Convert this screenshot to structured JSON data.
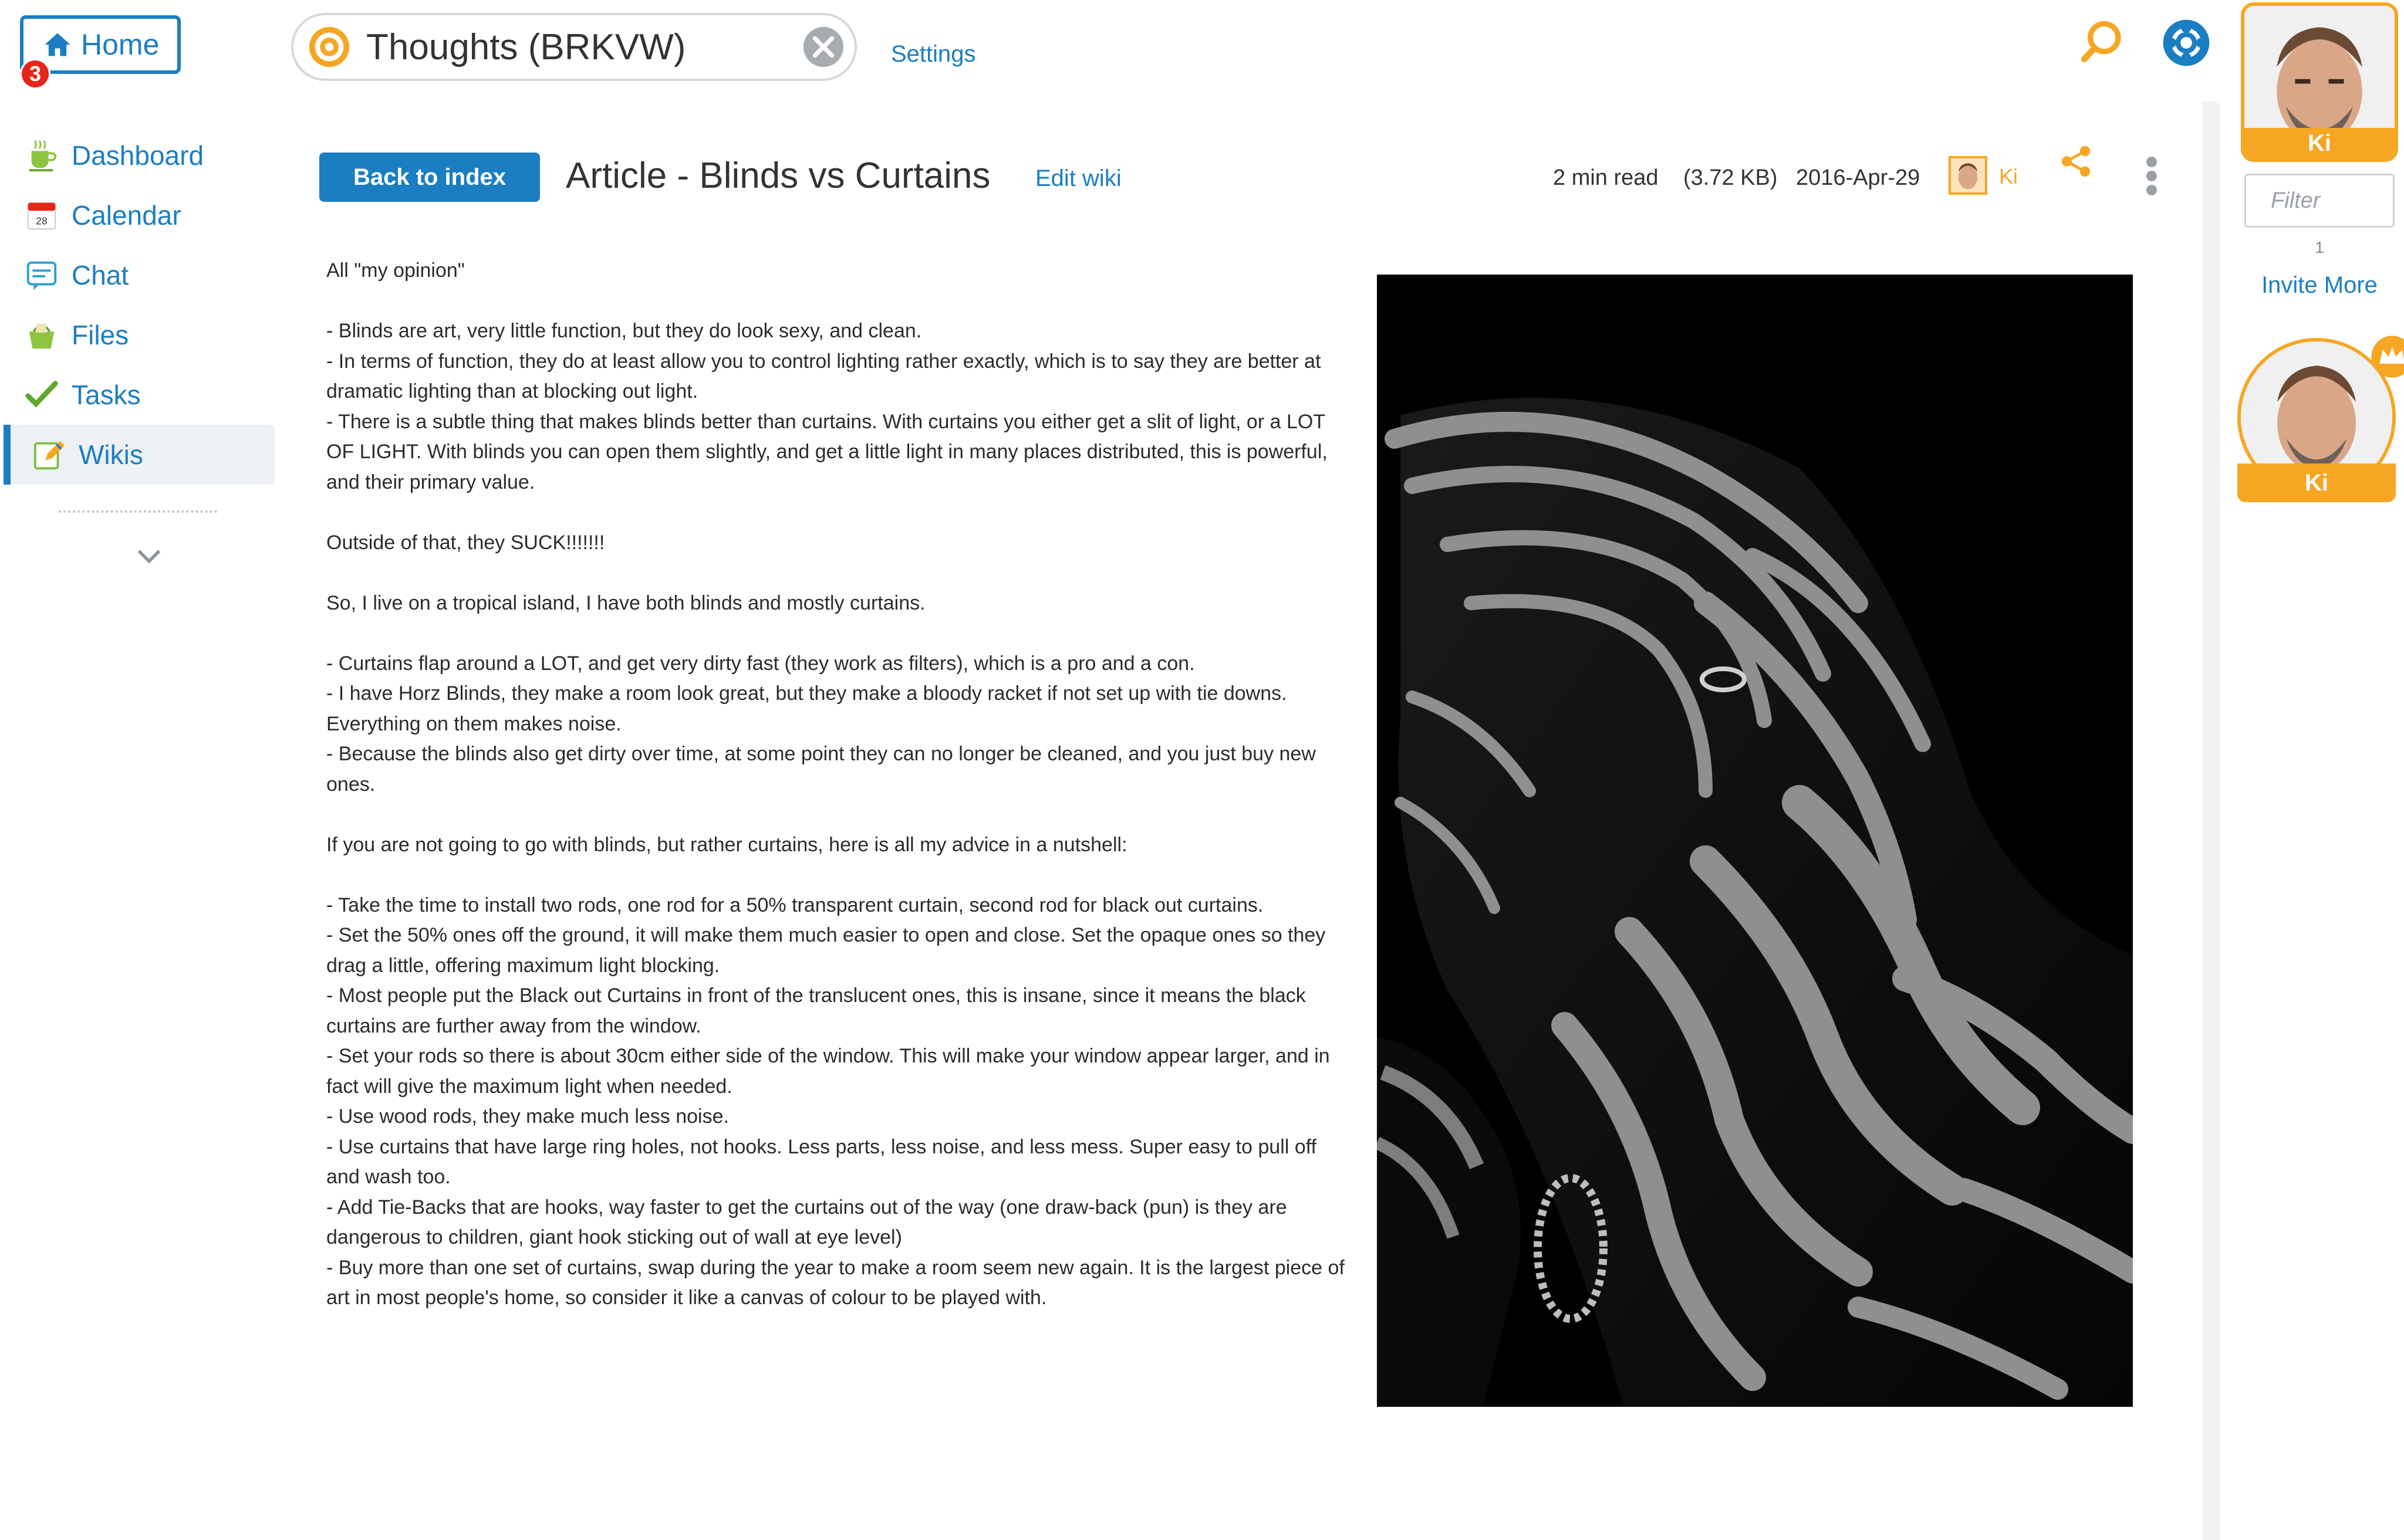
{
  "home": {
    "label": "Home",
    "badge_count": "3"
  },
  "sidebar": {
    "items": [
      {
        "label": "Dashboard",
        "icon": "dashboard-cup-icon"
      },
      {
        "label": "Calendar",
        "icon": "calendar-icon"
      },
      {
        "label": "Chat",
        "icon": "chat-icon"
      },
      {
        "label": "Files",
        "icon": "files-basket-icon"
      },
      {
        "label": "Tasks",
        "icon": "checkmark-icon"
      },
      {
        "label": "Wikis",
        "icon": "wiki-edit-icon",
        "active": true
      }
    ]
  },
  "topbar": {
    "workspace_title": "Thoughts (BRKVW)",
    "settings_label": "Settings"
  },
  "right_panel": {
    "user_name": "Ki",
    "filter_placeholder": "Filter",
    "member_count": "1",
    "invite_label": "Invite More",
    "member_name": "Ki"
  },
  "article": {
    "back_label": "Back to index",
    "title": "Article - Blinds vs Curtains",
    "edit_label": "Edit wiki",
    "read_time": "2 min read",
    "size": "(3.72 KB)",
    "date": "2016-Apr-29",
    "author": "Ki",
    "paragraphs": [
      "All \"my opinion\"",
      "- Blinds are art, very little function, but they do look sexy, and clean.\n- In terms of function, they do at least allow you to control lighting rather exactly, which is to say they are better at dramatic lighting than at blocking out light.\n- There is a subtle thing that makes blinds better than curtains. With curtains you either get a slit of light, or a LOT OF LIGHT. With blinds you can open them slightly, and get a little light in many places distributed, this is powerful, and their primary value.",
      "Outside of that, they SUCK!!!!!!!",
      "So, I live on a tropical island, I have both blinds and mostly curtains.",
      "- Curtains flap around a LOT, and get very dirty fast (they work as filters), which is a pro and a con.\n- I have Horz Blinds, they make a room look great, but they make a bloody racket if not set up with tie downs. Everything on them makes noise.\n- Because the blinds also get dirty over time, at some point they can no longer be cleaned, and you just buy new ones.",
      "If you are not going to go with blinds, but rather curtains, here is all my advice in a nutshell:",
      "- Take the time to install two rods, one rod for a 50% transparent curtain, second rod for black out curtains.\n- Set the 50% ones off the ground, it will make them much easier to open and close. Set the opaque ones so they drag a little, offering maximum light blocking.\n- Most people put the Black out Curtains in front of the translucent ones, this is insane, since it means the black curtains are further away from the window.\n- Set your rods so there is about 30cm either side of the window. This will make your window appear larger, and in fact will give the maximum light when needed.\n- Use wood rods, they make much less noise.\n- Use curtains that have large ring holes, not hooks. Less parts, less noise, and less mess. Super easy to pull off and wash too.\n- Add Tie-Backs that are hooks, way faster to get the curtains out of the way (one draw-back (pun) is they are dangerous to children, giant hook sticking out of wall at eye level)\n- Buy more than one set of curtains, swap during the year to make a room seem new again. It is the largest piece of art in most people's home, so consider it like a canvas of colour to be played with."
    ]
  },
  "colors": {
    "accent": "#1b7ec2",
    "avatar_highlight": "#f5a623",
    "badge": "#e8251b",
    "active_bg": "#edf1f5"
  }
}
